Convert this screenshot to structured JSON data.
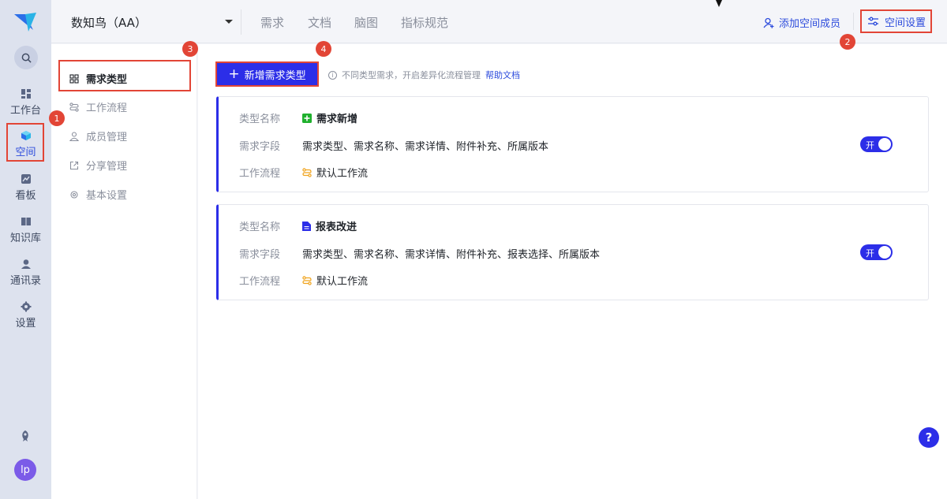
{
  "rail": {
    "items": [
      {
        "label": "工作台",
        "icon": "dashboard-icon"
      },
      {
        "label": "空间",
        "icon": "cube-icon",
        "active": true
      },
      {
        "label": "看板",
        "icon": "chart-icon"
      },
      {
        "label": "知识库",
        "icon": "book-icon"
      },
      {
        "label": "通讯录",
        "icon": "contacts-icon"
      },
      {
        "label": "设置",
        "icon": "gear-icon"
      }
    ],
    "avatar": "lp"
  },
  "topbar": {
    "space_name": "数知鸟（AA）",
    "tabs": [
      "需求",
      "文档",
      "脑图",
      "指标规范"
    ],
    "add_member": "添加空间成员",
    "space_settings": "空间设置"
  },
  "submenu": {
    "items": [
      {
        "label": "需求类型",
        "active": true
      },
      {
        "label": "工作流程"
      },
      {
        "label": "成员管理"
      },
      {
        "label": "分享管理"
      },
      {
        "label": "基本设置"
      }
    ]
  },
  "main": {
    "new_button": "新增需求类型",
    "hint": "不同类型需求，开启差异化流程管理",
    "help_link": "帮助文档",
    "labels": {
      "type_name": "类型名称",
      "fields": "需求字段",
      "workflow": "工作流程"
    },
    "toggle_text": "开",
    "cards": [
      {
        "name": "需求新增",
        "name_color": "#1fb02d",
        "fields": "需求类型、需求名称、需求详情、附件补充、所属版本",
        "workflow": "默认工作流",
        "enabled": true
      },
      {
        "name": "报表改进",
        "name_color": "#2c2ee8",
        "fields": "需求类型、需求名称、需求详情、附件补充、报表选择、所属版本",
        "workflow": "默认工作流",
        "enabled": true
      }
    ]
  },
  "badges": [
    "1",
    "2",
    "3",
    "4"
  ],
  "help_fab": "?",
  "colors": {
    "accent": "#2c2ee8",
    "link": "#2c4bdc",
    "annotation": "#e24536"
  }
}
